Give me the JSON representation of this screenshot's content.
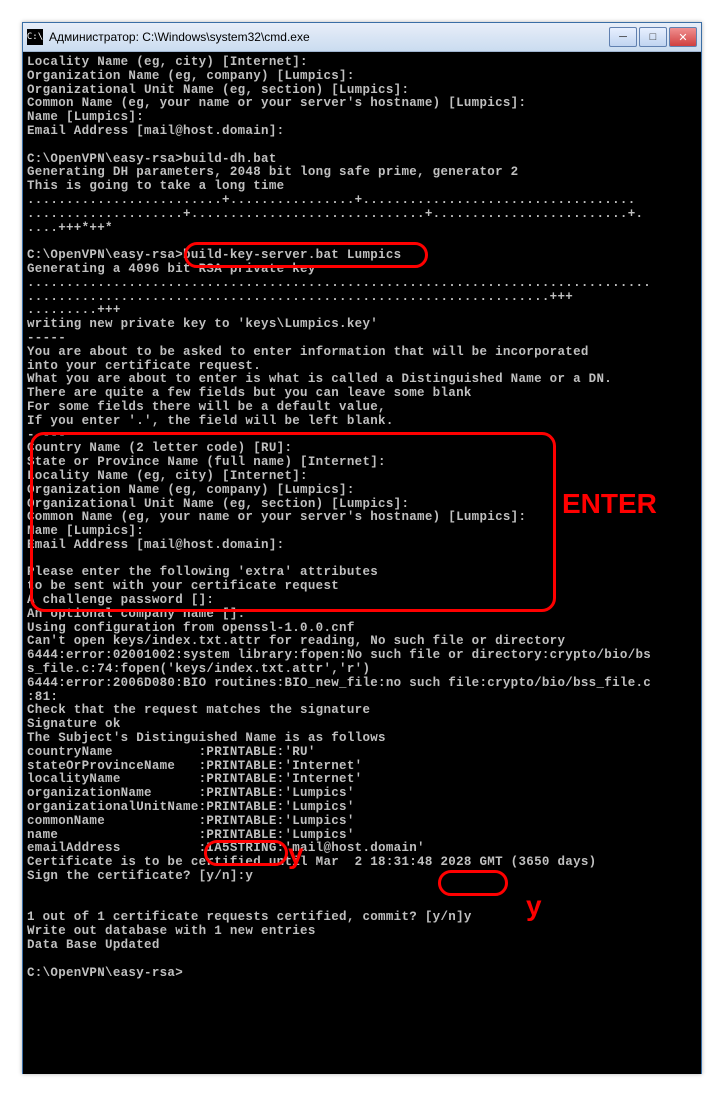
{
  "window": {
    "title": "Администратор: C:\\Windows\\system32\\cmd.exe",
    "icon_text": "C:\\"
  },
  "terminal": {
    "lines": [
      "Locality Name (eg, city) [Internet]:",
      "Organization Name (eg, company) [Lumpics]:",
      "Organizational Unit Name (eg, section) [Lumpics]:",
      "Common Name (eg, your name or your server's hostname) [Lumpics]:",
      "Name [Lumpics]:",
      "Email Address [mail@host.domain]:",
      "",
      "C:\\OpenVPN\\easy-rsa>build-dh.bat",
      "Generating DH parameters, 2048 bit long safe prime, generator 2",
      "This is going to take a long time",
      ".........................+................+...................................",
      "....................+..............................+.........................+.",
      "....+++*++*",
      "",
      "C:\\OpenVPN\\easy-rsa>build-key-server.bat Lumpics",
      "Generating a 4096 bit RSA private key",
      "................................................................................",
      "...................................................................+++",
      ".........+++",
      "writing new private key to 'keys\\Lumpics.key'",
      "-----",
      "You are about to be asked to enter information that will be incorporated",
      "into your certificate request.",
      "What you are about to enter is what is called a Distinguished Name or a DN.",
      "There are quite a few fields but you can leave some blank",
      "For some fields there will be a default value,",
      "If you enter '.', the field will be left blank.",
      "-----",
      "Country Name (2 letter code) [RU]:",
      "State or Province Name (full name) [Internet]:",
      "Locality Name (eg, city) [Internet]:",
      "Organization Name (eg, company) [Lumpics]:",
      "Organizational Unit Name (eg, section) [Lumpics]:",
      "Common Name (eg, your name or your server's hostname) [Lumpics]:",
      "Name [Lumpics]:",
      "Email Address [mail@host.domain]:",
      "",
      "Please enter the following 'extra' attributes",
      "to be sent with your certificate request",
      "A challenge password []:",
      "An optional company name []:",
      "Using configuration from openssl-1.0.0.cnf",
      "Can't open keys/index.txt.attr for reading, No such file or directory",
      "6444:error:02001002:system library:fopen:No such file or directory:crypto/bio/bs",
      "s_file.c:74:fopen('keys/index.txt.attr','r')",
      "6444:error:2006D080:BIO routines:BIO_new_file:no such file:crypto/bio/bss_file.c",
      ":81:",
      "Check that the request matches the signature",
      "Signature ok",
      "The Subject's Distinguished Name is as follows",
      "countryName           :PRINTABLE:'RU'",
      "stateOrProvinceName   :PRINTABLE:'Internet'",
      "localityName          :PRINTABLE:'Internet'",
      "organizationName      :PRINTABLE:'Lumpics'",
      "organizationalUnitName:PRINTABLE:'Lumpics'",
      "commonName            :PRINTABLE:'Lumpics'",
      "name                  :PRINTABLE:'Lumpics'",
      "emailAddress          :IA5STRING:'mail@host.domain'",
      "Certificate is to be certified until Mar  2 18:31:48 2028 GMT (3650 days)",
      "Sign the certificate? [y/n]:y",
      "",
      "",
      "1 out of 1 certificate requests certified, commit? [y/n]y",
      "Write out database with 1 new entries",
      "Data Base Updated",
      "",
      "C:\\OpenVPN\\easy-rsa>"
    ]
  },
  "annotations": {
    "enter": "ENTER",
    "y1": "y",
    "y2": "y"
  }
}
